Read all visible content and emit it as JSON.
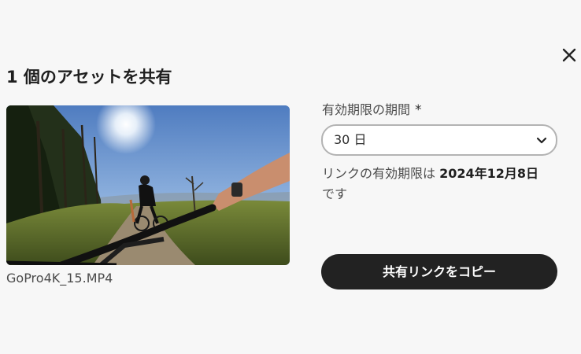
{
  "dialog": {
    "title": "1 個のアセットを共有"
  },
  "asset": {
    "file_name": "GoPro4K_15.MP4"
  },
  "expiration": {
    "label": "有効期限の期間",
    "required_mark": "*",
    "selected_value": "30 日",
    "info_prefix": "リンクの有効期限は",
    "info_date": "2024年12月8日",
    "info_suffix": "です"
  },
  "actions": {
    "copy_link_label": "共有リンクをコピー"
  },
  "icons": {
    "close": "close-icon",
    "dropdown": "chevron-down-icon"
  },
  "colors": {
    "background": "#f7f7f7",
    "primary_button": "#222222",
    "primary_button_text": "#ffffff"
  }
}
